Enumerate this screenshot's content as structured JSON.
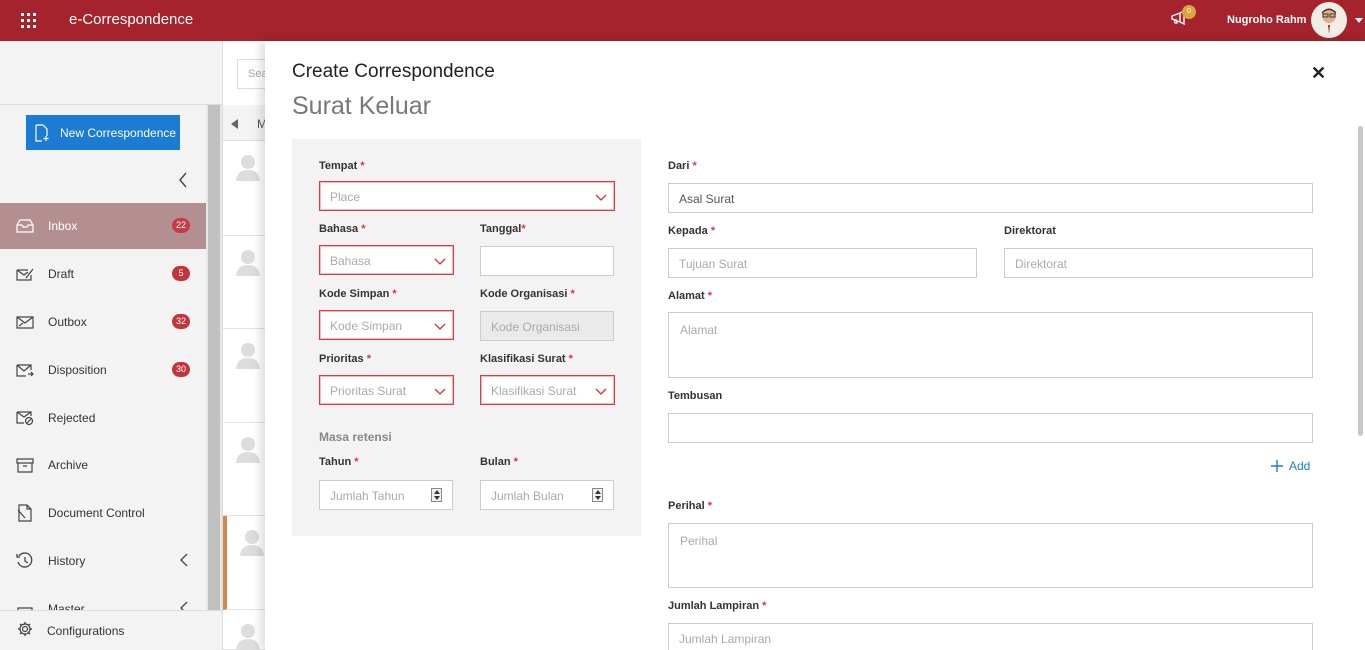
{
  "header": {
    "app_title": "e-Correspondence",
    "notif_count": "0",
    "user_name": "Nugroho Rahm"
  },
  "sidebar": {
    "new_button": "New Correspondence",
    "items": [
      {
        "label": "Inbox",
        "badge": "22",
        "icon": "inbox-icon"
      },
      {
        "label": "Draft",
        "badge": "5",
        "icon": "draft-icon"
      },
      {
        "label": "Outbox",
        "badge": "32",
        "icon": "outbox-icon"
      },
      {
        "label": "Disposition",
        "badge": "30",
        "icon": "disposition-icon"
      },
      {
        "label": "Rejected",
        "badge": "",
        "icon": "rejected-icon"
      },
      {
        "label": "Archive",
        "badge": "",
        "icon": "archive-icon"
      },
      {
        "label": "Document Control",
        "badge": "",
        "icon": "document-control-icon"
      },
      {
        "label": "History",
        "badge": "",
        "icon": "history-icon"
      },
      {
        "label": "Master",
        "badge": "",
        "icon": "master-icon"
      }
    ],
    "config_label": "Configurations"
  },
  "middle": {
    "search_placeholder": "Sea",
    "header_label": "M"
  },
  "panel": {
    "title": "Create Correspondence",
    "subtitle": "Surat Keluar",
    "left": {
      "tempat_label": "Tempat",
      "tempat_placeholder": "Place",
      "bahasa_label": "Bahasa",
      "bahasa_placeholder": "Bahasa",
      "tanggal_label": "Tanggal",
      "tanggal_value": "",
      "kode_simpan_label": "Kode Simpan",
      "kode_simpan_placeholder": "Kode Simpan",
      "kode_organisasi_label": "Kode Organisasi",
      "kode_organisasi_placeholder": "Kode Organisasi",
      "prioritas_label": "Prioritas",
      "prioritas_placeholder": "Prioritas Surat",
      "klasifikasi_label": "Klasifikasi Surat",
      "klasifikasi_placeholder": "Klasifikasi Surat",
      "masa_retensi_label": "Masa retensi",
      "tahun_label": "Tahun",
      "tahun_placeholder": "Jumlah Tahun",
      "bulan_label": "Bulan",
      "bulan_placeholder": "Jumlah Bulan"
    },
    "right": {
      "dari_label": "Dari",
      "dari_value": "Asal Surat",
      "kepada_label": "Kepada",
      "kepada_placeholder": "Tujuan Surat",
      "direktorat_label": "Direktorat",
      "direktorat_placeholder": "Direktorat",
      "alamat_label": "Alamat",
      "alamat_placeholder": "Alamat",
      "tembusan_label": "Tembusan",
      "tembusan_value": "",
      "add_label": "Add",
      "perihal_label": "Perihal",
      "perihal_placeholder": "Perihal",
      "lampiran_label": "Jumlah Lampiran",
      "lampiran_placeholder": "Jumlah Lampiran"
    },
    "required_mark": "*"
  },
  "colors": {
    "topbar": "#a4232c",
    "primary": "#1c7bd3",
    "badge": "#c4343b",
    "error_border": "#e23a3a",
    "active_item": "#b48f92"
  }
}
